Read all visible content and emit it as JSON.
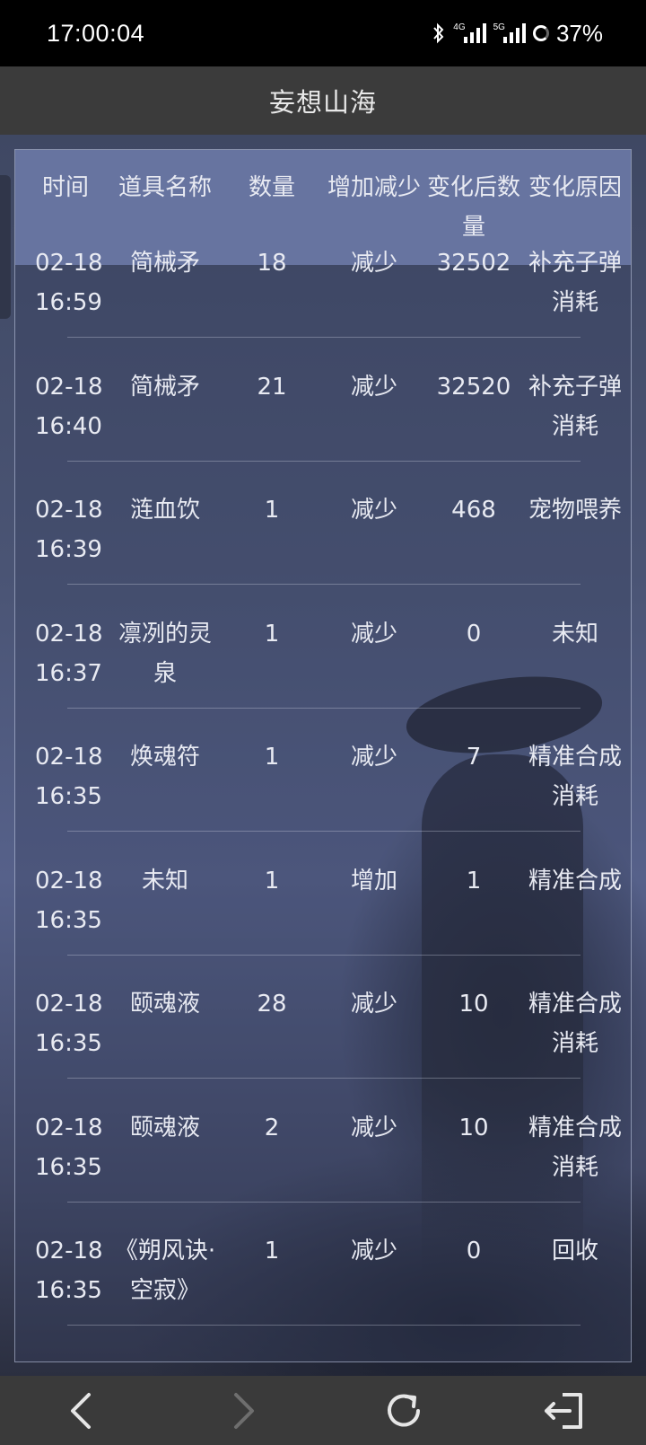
{
  "status_bar": {
    "time": "17:00:04",
    "network_labels": [
      "4G",
      "5G"
    ],
    "battery": "37%",
    "icons": [
      "bluetooth-icon",
      "signal-4g-icon",
      "signal-5g-icon",
      "battery-icon"
    ]
  },
  "title_bar": {
    "title": "妄想山海"
  },
  "table": {
    "headers": [
      "时间",
      "道具名称",
      "数量",
      "增加减少",
      "变化后数量",
      "变化原因"
    ],
    "rows": [
      {
        "date": "02-18",
        "time": "16:59",
        "item": "简械矛",
        "qty": "18",
        "change": "减少",
        "after": "32502",
        "reason": "补充子弹消耗"
      },
      {
        "date": "02-18",
        "time": "16:40",
        "item": "简械矛",
        "qty": "21",
        "change": "减少",
        "after": "32520",
        "reason": "补充子弹消耗"
      },
      {
        "date": "02-18",
        "time": "16:39",
        "item": "涟血饮",
        "qty": "1",
        "change": "减少",
        "after": "468",
        "reason": "宠物喂养"
      },
      {
        "date": "02-18",
        "time": "16:37",
        "item": "凛冽的灵泉",
        "qty": "1",
        "change": "减少",
        "after": "0",
        "reason": "未知"
      },
      {
        "date": "02-18",
        "time": "16:35",
        "item": "焕魂符",
        "qty": "1",
        "change": "减少",
        "after": "7",
        "reason": "精准合成消耗"
      },
      {
        "date": "02-18",
        "time": "16:35",
        "item": "未知",
        "qty": "1",
        "change": "增加",
        "after": "1",
        "reason": "精准合成"
      },
      {
        "date": "02-18",
        "time": "16:35",
        "item": "颐魂液",
        "qty": "28",
        "change": "减少",
        "after": "10",
        "reason": "精准合成消耗"
      },
      {
        "date": "02-18",
        "time": "16:35",
        "item": "颐魂液",
        "qty": "2",
        "change": "减少",
        "after": "10",
        "reason": "精准合成消耗"
      },
      {
        "date": "02-18",
        "time": "16:35",
        "item": "《朔风诀·空寂》",
        "qty": "1",
        "change": "减少",
        "after": "0",
        "reason": "回收"
      }
    ]
  },
  "nav_bar": {
    "icons": [
      "back-icon",
      "forward-icon",
      "refresh-icon",
      "exit-icon"
    ]
  }
}
